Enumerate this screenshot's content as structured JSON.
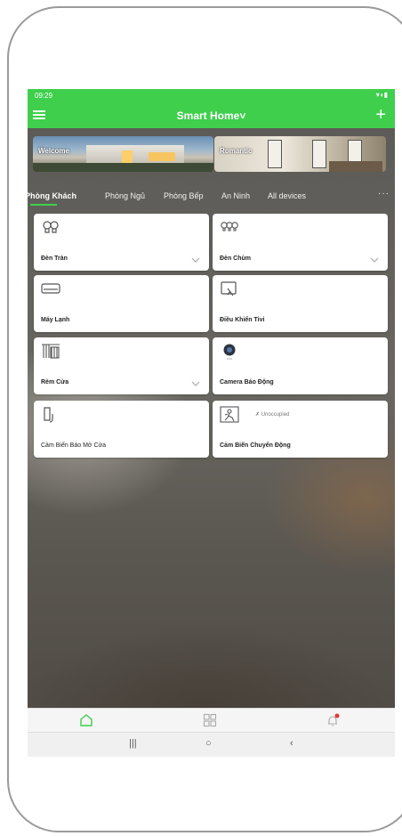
{
  "status_bar": {
    "time": "09:29",
    "indicators": "▾◖▮"
  },
  "app_bar": {
    "title": "Smart Home˅",
    "add_label": "+"
  },
  "scenes": [
    {
      "label": "Welcome"
    },
    {
      "label": "Romantic"
    }
  ],
  "tabs": [
    {
      "label": "Phòng Khách",
      "active": true
    },
    {
      "label": "Phòng Ngủ",
      "active": false
    },
    {
      "label": "Phòng Bếp",
      "active": false
    },
    {
      "label": "An Ninh",
      "active": false
    },
    {
      "label": "All devices",
      "active": false
    }
  ],
  "more_label": "···",
  "devices": [
    {
      "name": "Đèn Tràn",
      "icon": "bulb-icon"
    },
    {
      "name": "Đèn Chùm",
      "icon": "chandelier-icon"
    },
    {
      "name": "Máy Lạnh",
      "icon": "air-conditioner-icon"
    },
    {
      "name": "Điều Khiển Tivi",
      "icon": "tv-remote-icon"
    },
    {
      "name": "Rèm Cửa",
      "icon": "curtain-icon"
    },
    {
      "name": "Camera Báo Động",
      "icon": "camera-icon"
    },
    {
      "name": "Cảm Biến Báo Mở Cửa",
      "icon": "door-sensor-icon"
    },
    {
      "name": "Cảm Biến Chuyển Động",
      "icon": "motion-sensor-icon",
      "state": "Unoccupied"
    }
  ],
  "bottom_nav": {
    "items": [
      {
        "icon": "home-icon",
        "active": true
      },
      {
        "icon": "grid-icon",
        "active": false
      },
      {
        "icon": "alarm-bell-icon",
        "active": false,
        "badge": true
      }
    ]
  },
  "colors": {
    "accent": "#3fcf4d",
    "badge": "#e53935"
  }
}
